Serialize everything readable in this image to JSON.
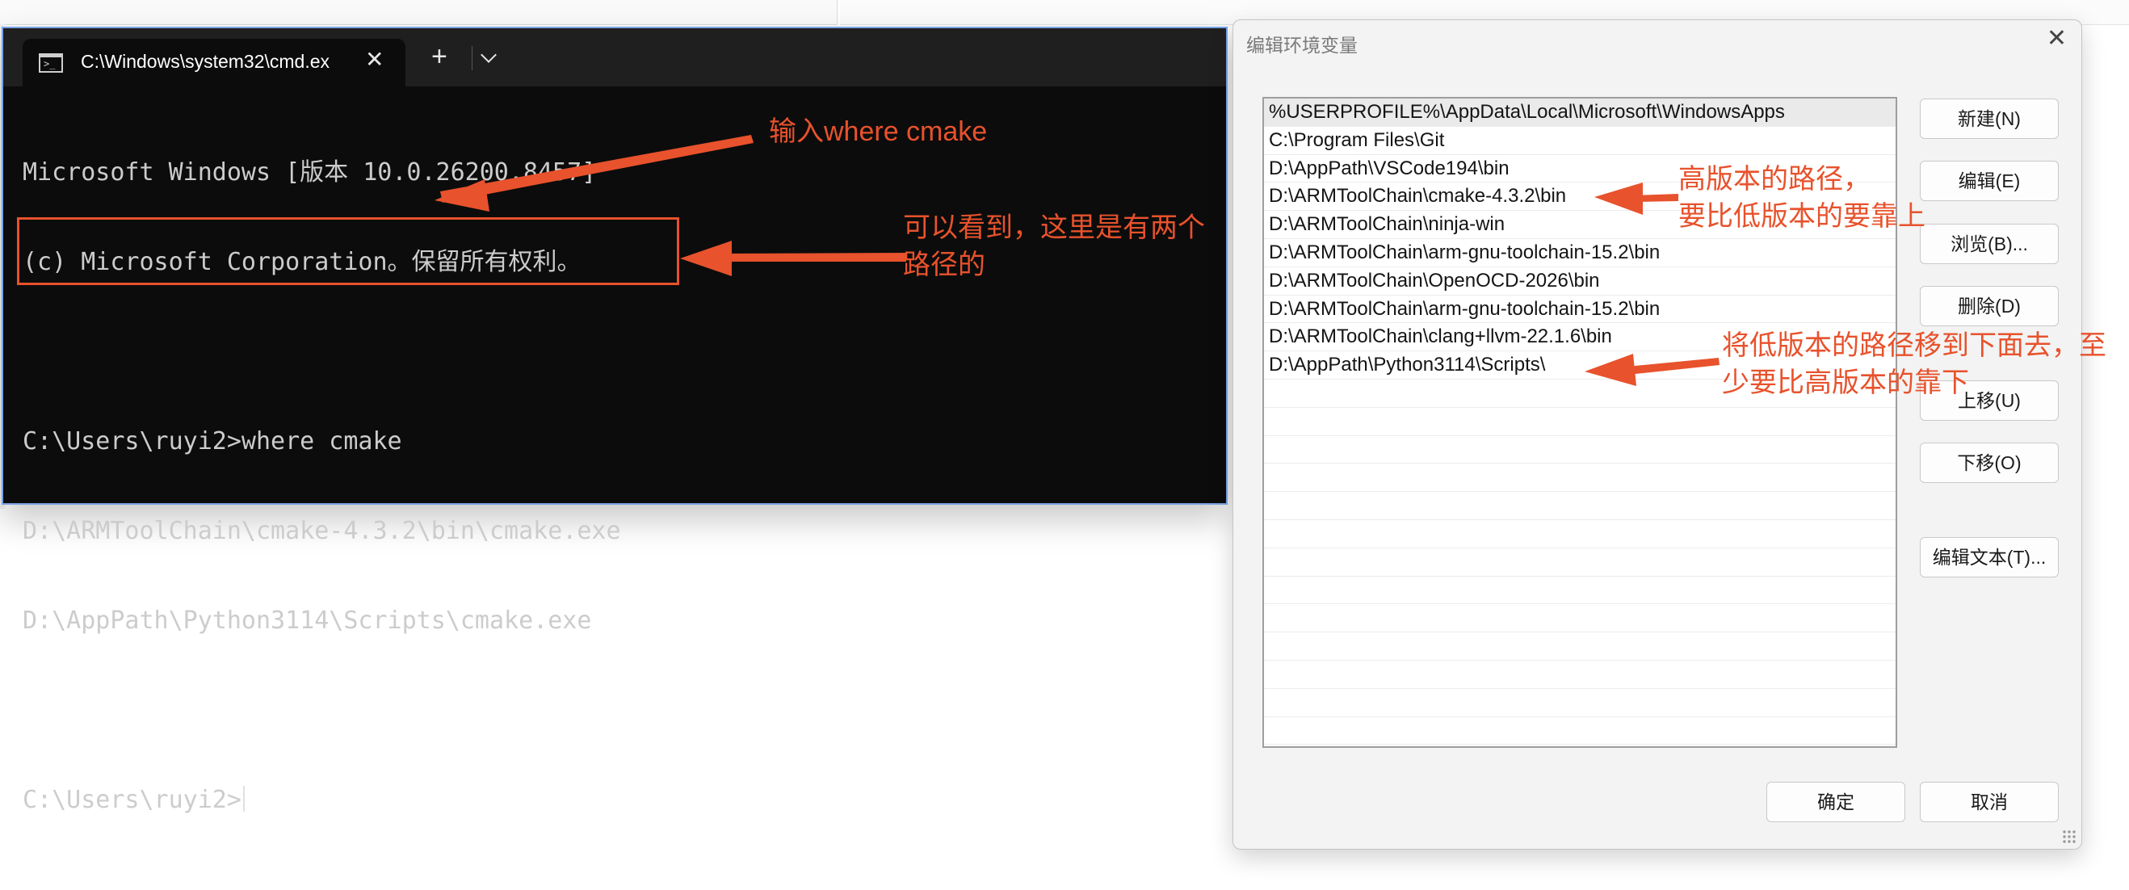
{
  "terminal": {
    "tab_title": "C:\\Windows\\system32\\cmd.ex",
    "tab_icon": "terminal-icon",
    "lines": [
      "Microsoft Windows [版本 10.0.26200.8457]",
      "(c) Microsoft Corporation。保留所有权利。",
      "",
      "C:\\Users\\ruyi2>where cmake",
      "D:\\ARMToolChain\\cmake-4.3.2\\bin\\cmake.exe",
      "D:\\AppPath\\Python3114\\Scripts\\cmake.exe",
      "",
      "C:\\Users\\ruyi2>"
    ]
  },
  "dialog": {
    "title": "编辑环境变量",
    "paths": [
      "%USERPROFILE%\\AppData\\Local\\Microsoft\\WindowsApps",
      "C:\\Program Files\\Git",
      "D:\\AppPath\\VSCode194\\bin",
      "D:\\ARMToolChain\\cmake-4.3.2\\bin",
      "D:\\ARMToolChain\\ninja-win",
      "D:\\ARMToolChain\\arm-gnu-toolchain-15.2\\bin",
      "D:\\ARMToolChain\\OpenOCD-2026\\bin",
      "D:\\ARMToolChain\\arm-gnu-toolchain-15.2\\bin",
      "D:\\ARMToolChain\\clang+llvm-22.1.6\\bin",
      "D:\\AppPath\\Python3114\\Scripts\\",
      "",
      "",
      "",
      "",
      "",
      "",
      "",
      "",
      "",
      "",
      "",
      "",
      "",
      ""
    ],
    "buttons": {
      "new": "新建(N)",
      "edit": "编辑(E)",
      "browse": "浏览(B)...",
      "delete": "删除(D)",
      "move_up": "上移(U)",
      "move_down": "下移(O)",
      "edit_text": "编辑文本(T)...",
      "ok": "确定",
      "cancel": "取消"
    }
  },
  "annotations": {
    "input_cmd": "输入where cmake",
    "two_paths_1": "可以看到，这里是有两个",
    "two_paths_2": "路径的",
    "high_ver_1": "高版本的路径，",
    "high_ver_2": "要比低版本的要靠上",
    "low_ver_1": "将低版本的路径移到下面去，至",
    "low_ver_2": "少要比高版本的靠下",
    "color": "#e8522c"
  }
}
